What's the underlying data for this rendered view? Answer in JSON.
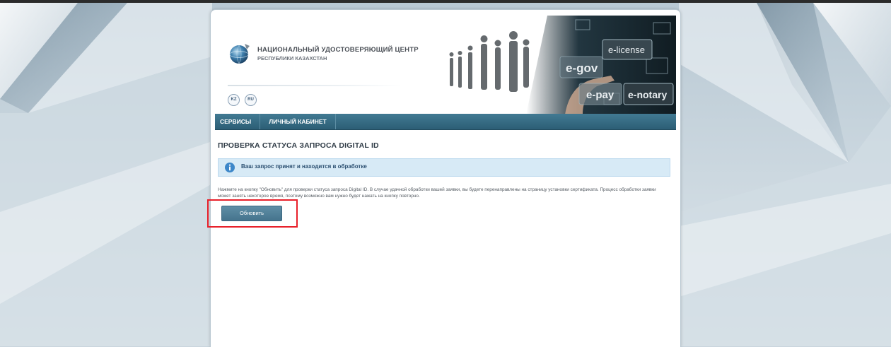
{
  "header": {
    "org_name_line1": "НАЦИОНАЛЬНЫЙ УДОСТОВЕРЯЮЩИЙ ЦЕНТР",
    "org_name_line2": "РЕСПУБЛИКИ КАЗАХСТАН",
    "languages": [
      {
        "code": "KZ",
        "label": "KZ"
      },
      {
        "code": "RU",
        "label": "RU"
      }
    ],
    "promo_tiles": [
      "e-gov",
      "e-license",
      "e-pay",
      "e-notary"
    ]
  },
  "nav": {
    "items": [
      {
        "label": "СЕРВИСЫ"
      },
      {
        "label": "ЛИЧНЫЙ КАБИНЕТ"
      }
    ]
  },
  "main": {
    "title": "ПРОВЕРКА СТАТУСА ЗАПРОСА DIGITAL ID",
    "alert": {
      "icon": "info-icon",
      "text": "Ваш запрос принят и находится в обработке"
    },
    "description": "Нажмите на кнопку \"Обновить\" для проверки статуса запроса Digital ID. В случае удачной обработки вашей заявки, вы будете перенаправлены на страницу установки сертификата. Процесс обработки заявки может занять некоторое время, поэтому возможно вам нужно будет нажать на кнопку повторно.",
    "refresh_button_label": "Обновить"
  },
  "colors": {
    "nav_bar": "#2f6279",
    "alert_background": "#d7eaf6",
    "button": "#52819a",
    "highlight": "#e8202a"
  }
}
